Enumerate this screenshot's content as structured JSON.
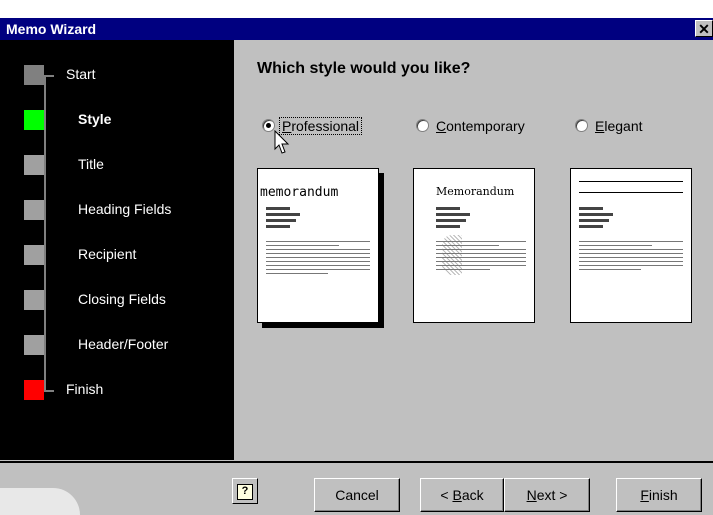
{
  "window": {
    "title": "Memo Wizard",
    "close_glyph": "✕"
  },
  "steps": [
    {
      "label": "Start",
      "state": "done"
    },
    {
      "label": "Style",
      "state": "current"
    },
    {
      "label": "Title",
      "state": "pending"
    },
    {
      "label": "Heading Fields",
      "state": "pending"
    },
    {
      "label": "Recipient",
      "state": "pending"
    },
    {
      "label": "Closing Fields",
      "state": "pending"
    },
    {
      "label": "Header/Footer",
      "state": "pending"
    },
    {
      "label": "Finish",
      "state": "end"
    }
  ],
  "main": {
    "question": "Which style would you like?",
    "options": [
      {
        "label": "Professional",
        "selected": true,
        "preview_heading": "memorandum"
      },
      {
        "label": "Contemporary",
        "selected": false,
        "preview_heading": "Memorandum"
      },
      {
        "label": "Elegant",
        "selected": false,
        "preview_heading": ""
      }
    ]
  },
  "buttons": {
    "help": "?",
    "cancel": "Cancel",
    "back_prefix": "< ",
    "back_mnemonic": "B",
    "back_rest": "ack",
    "next_mnemonic": "N",
    "next_rest": "ext >",
    "finish_mnemonic": "F",
    "finish_rest": "inish"
  },
  "colors": {
    "titlebar": "#000080",
    "current_step": "#00ff00",
    "finish_step": "#ff0000",
    "face": "#c0c0c0"
  }
}
